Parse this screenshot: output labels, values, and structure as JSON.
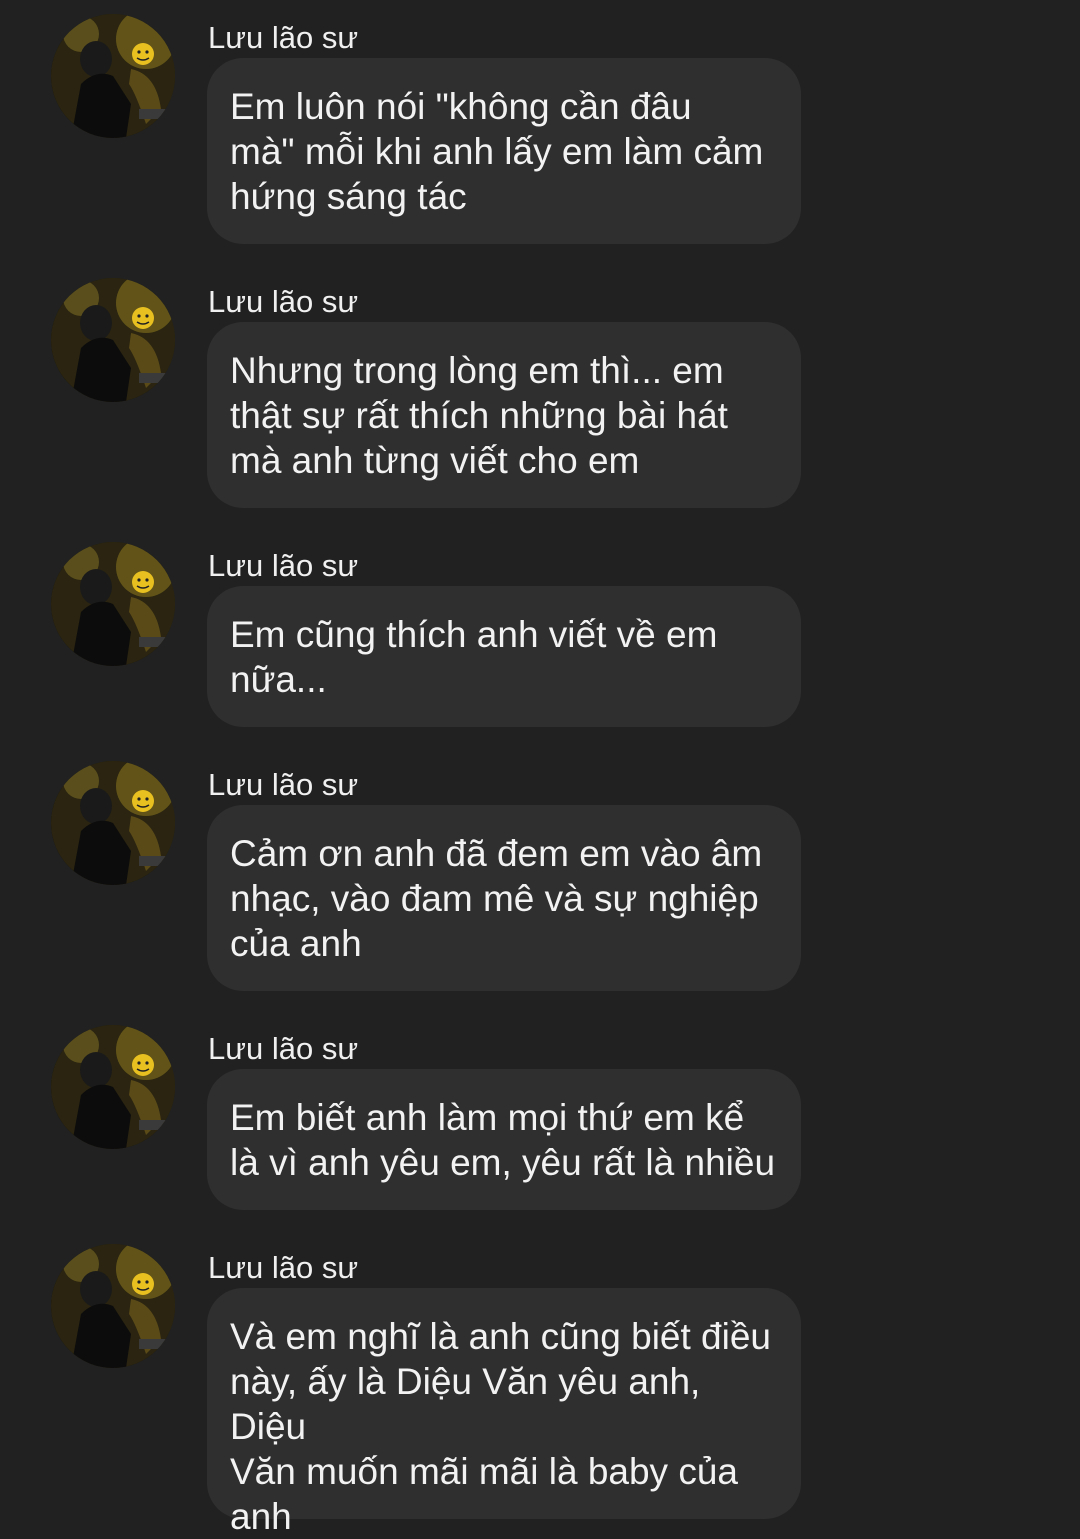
{
  "chat": {
    "sender_name": "Lưu lão sư",
    "messages": [
      {
        "sender": "Lưu lão sư",
        "lines": "Em luôn nói \"không cần đâu\nmà\" mỗi khi anh lấy em làm cảm\nhứng sáng tác"
      },
      {
        "sender": "Lưu lão sư",
        "lines": "Nhưng trong lòng em thì... em\nthật sự rất thích những bài hát\nmà anh từng viết cho em"
      },
      {
        "sender": "Lưu lão sư",
        "lines": "Em cũng thích anh viết về em\nnữa..."
      },
      {
        "sender": "Lưu lão sư",
        "lines": "Cảm ơn anh đã đem em vào âm\nnhạc, vào đam mê và sự nghiệp\ncủa anh"
      },
      {
        "sender": "Lưu lão sư",
        "lines": "Em biết anh làm mọi thứ em kể\nlà vì anh yêu em, yêu rất là nhiều"
      },
      {
        "sender": "Lưu lão sư",
        "lines": "Và em nghĩ là anh cũng biết điều\nnày, ấy là Diệu Văn yêu anh, Diệu\nVăn muốn mãi mãi là baby của\nanh"
      }
    ]
  },
  "colors": {
    "background": "#212121",
    "bubble": "#2f2f2f",
    "text": "#f2f2f2"
  },
  "icons": {
    "avatar": "profile-photo"
  }
}
